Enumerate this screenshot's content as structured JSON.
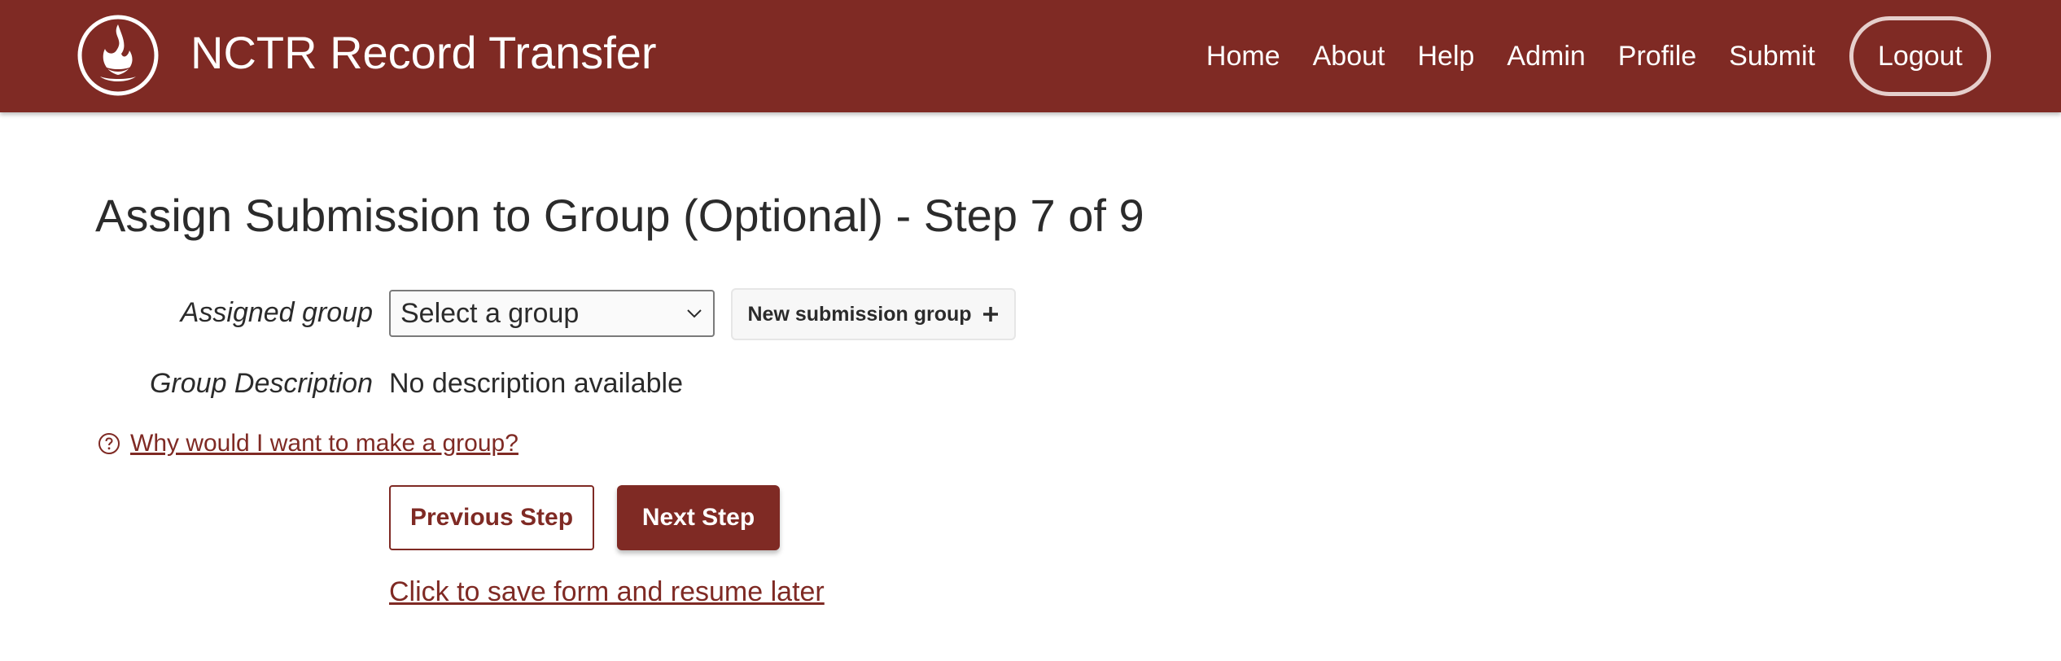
{
  "header": {
    "title": "NCTR Record Transfer",
    "logo_icon": "flame-logo-icon",
    "nav": [
      {
        "label": "Home"
      },
      {
        "label": "About"
      },
      {
        "label": "Help"
      },
      {
        "label": "Admin"
      },
      {
        "label": "Profile"
      },
      {
        "label": "Submit"
      }
    ],
    "logout_label": "Logout"
  },
  "main": {
    "title": "Assign Submission to Group (Optional) - Step 7 of 9",
    "assigned_group": {
      "label": "Assigned group",
      "selected": "Select a group"
    },
    "new_group_button": "New submission group",
    "group_description": {
      "label": "Group Description",
      "value": "No description available"
    },
    "help_link": "Why would I want to make a group?",
    "previous_button": "Previous Step",
    "next_button": "Next Step",
    "save_link": "Click to save form and resume later"
  },
  "colors": {
    "brand": "#7f2a24",
    "header_text": "#ffffff",
    "body_text": "#2b2b2b"
  }
}
